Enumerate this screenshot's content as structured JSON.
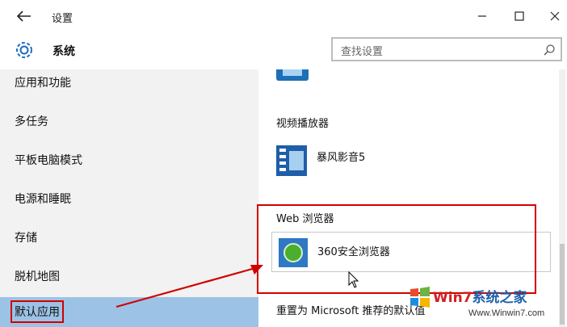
{
  "window": {
    "title": "设置"
  },
  "header": {
    "title": "系统",
    "search_placeholder": "查找设置"
  },
  "sidebar": {
    "items": [
      {
        "label": "应用和功能"
      },
      {
        "label": "多任务"
      },
      {
        "label": "平板电脑模式"
      },
      {
        "label": "电源和睡眠"
      },
      {
        "label": "存储"
      },
      {
        "label": "脱机地图"
      },
      {
        "label": "默认应用",
        "active": true
      }
    ]
  },
  "content": {
    "video_section_label": "视频播放器",
    "video_app_name": "暴风影音5",
    "web_section_label": "Web 浏览器",
    "browser_app_name": "360安全浏览器",
    "reset_label": "重置为 Microsoft 推荐的默认值"
  },
  "watermark": {
    "brand_prefix": "Win7",
    "brand_suffix": "系统之家",
    "url": "Www.Winwin7.com"
  },
  "colors": {
    "accent": "#9cc3e6",
    "highlight": "#d20000",
    "sidebar_bg": "#f2f2f2"
  }
}
